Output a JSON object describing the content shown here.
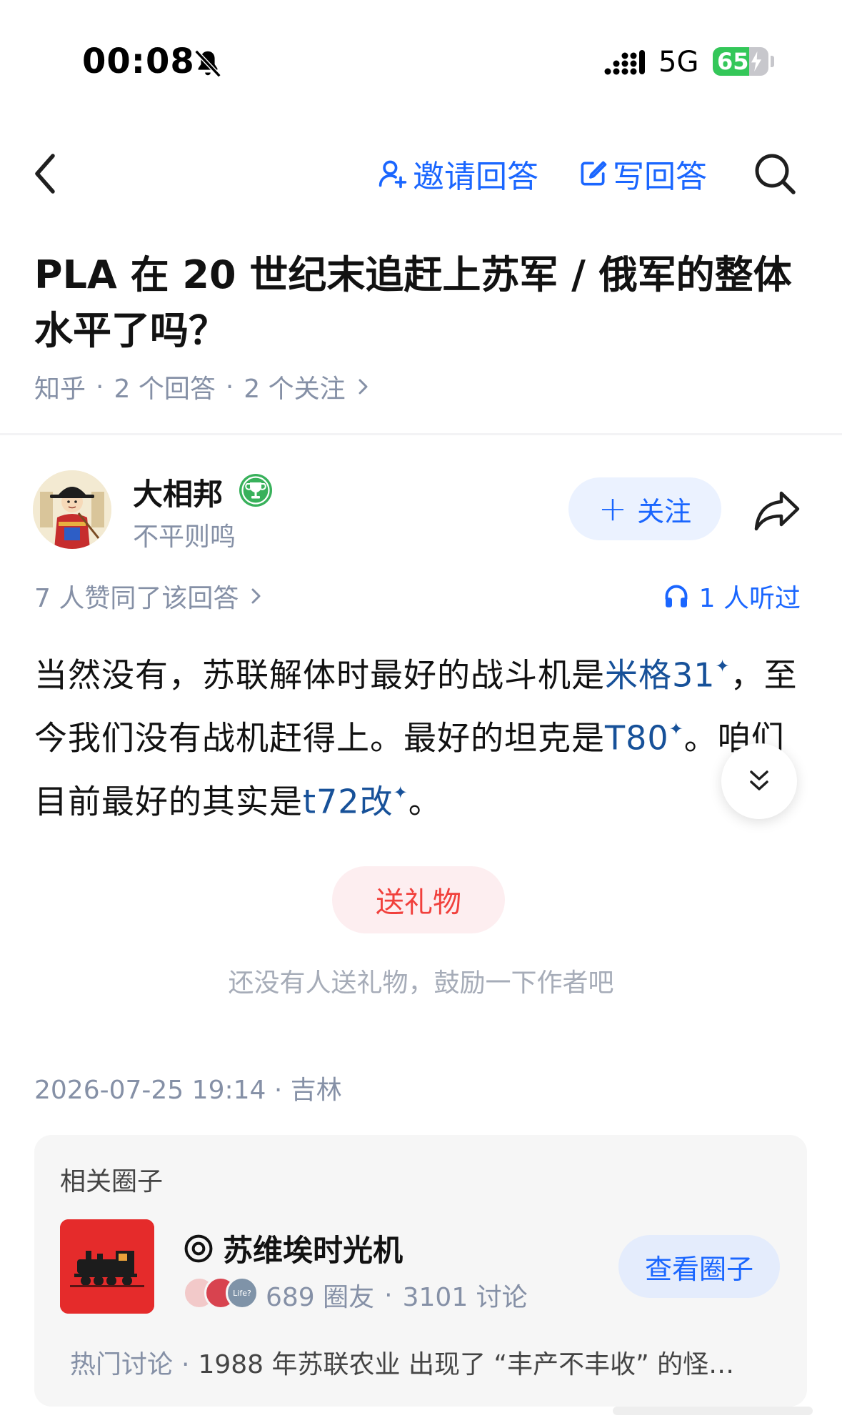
{
  "status_bar": {
    "time": "00:08",
    "network": "5G",
    "battery": "65",
    "battery_level": 0.65,
    "icons": [
      "bell-slash-icon",
      "signal-icon",
      "battery-icon",
      "charging-bolt-icon"
    ]
  },
  "nav": {
    "invite": "邀请回答",
    "write": "写回答",
    "icons": [
      "chevron-left-icon",
      "person-add-icon",
      "pencil-square-icon",
      "search-icon"
    ]
  },
  "question": {
    "title": "PLA 在 20 世纪末追赶上苏军 / 俄军的整体水平了吗？",
    "source": "知乎",
    "answers": "2 个回答",
    "follows": "2 个关注"
  },
  "author": {
    "name": "大相邦",
    "bio": "不平则鸣",
    "follow_label": "关注"
  },
  "answer_meta": {
    "agree": "7 人赞同了该回答",
    "listened": "1 人听过"
  },
  "answer": {
    "seg1": "当然没有，苏联解体时最好的战斗机是",
    "kw1": "米格31",
    "seg2": "，至今我们没有战机赶得上。最好的坦克是",
    "kw2": "T80",
    "seg3": "。咱们目前最好的其实是",
    "kw3": "t72改",
    "seg4": "。",
    "mark": "✦"
  },
  "gift": {
    "button": "送礼物",
    "hint": "还没有人送礼物，鼓励一下作者吧"
  },
  "post_meta": "2026-07-25 19:14 · 吉林",
  "related_circle": {
    "title": "相关圈子",
    "name": "苏维埃时光机",
    "members": "689 圈友",
    "discussions": "3101 讨论",
    "view_button": "查看圈子",
    "hot_label": "热门讨论",
    "hot_topic": "1988 年苏联农业 出现了 “丰产不丰收” 的怪…",
    "avatar_badge": "Life?"
  },
  "colors": {
    "accent": "#1a66ff",
    "link": "#175199",
    "gift_red": "#f1403c",
    "meta_gray": "#8590a6"
  }
}
